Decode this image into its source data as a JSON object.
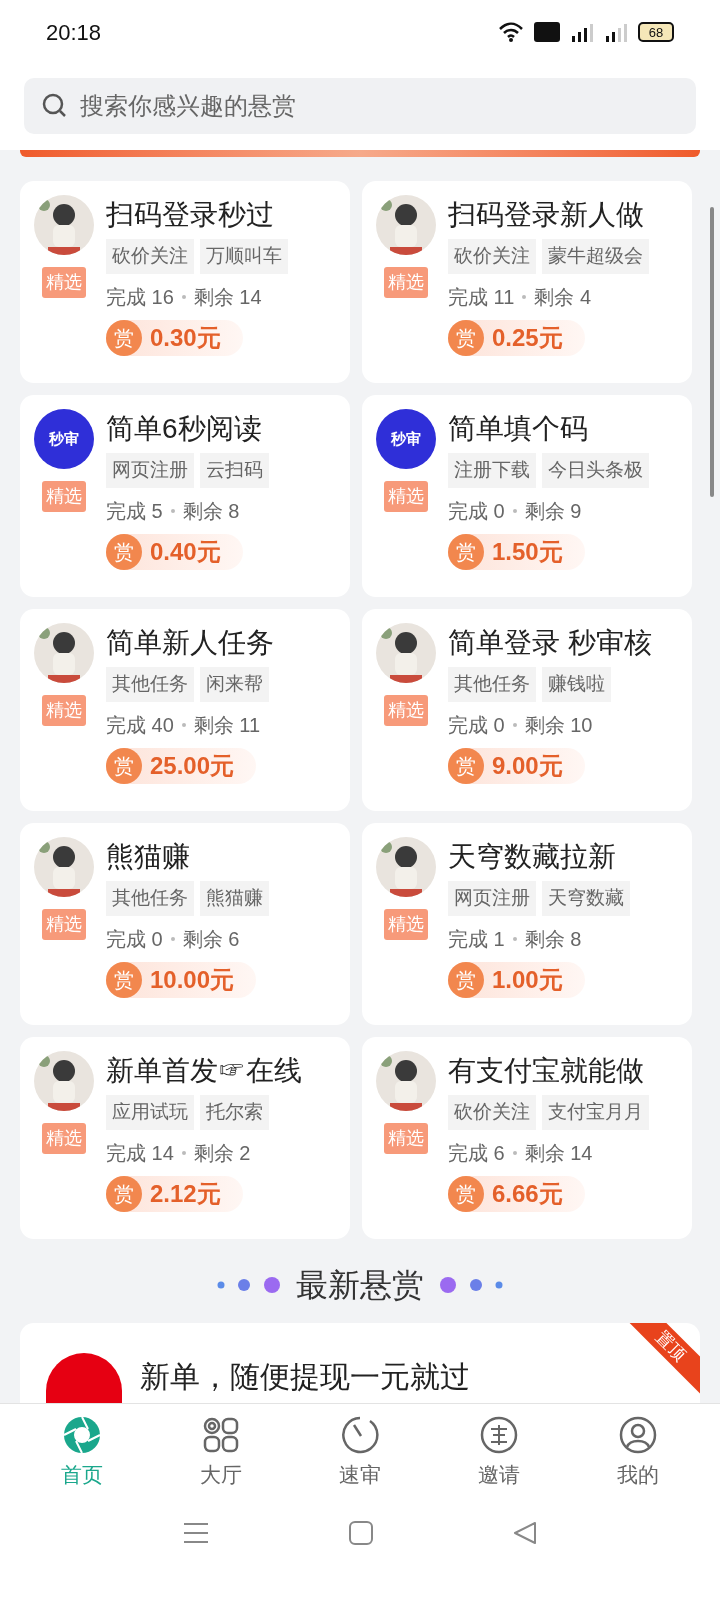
{
  "status_bar": {
    "time": "20:18",
    "battery": "68"
  },
  "search": {
    "placeholder": "搜索你感兴趣的悬赏"
  },
  "cards": [
    {
      "title": "扫码登录秒过",
      "badge": "精选",
      "tags": [
        "砍价关注",
        "万顺叫车"
      ],
      "done": "完成 16",
      "left": "剩余 14",
      "reward_icon": "赏",
      "reward": "0.30元"
    },
    {
      "title": "扫码登录新人做",
      "badge": "精选",
      "tags": [
        "砍价关注",
        "蒙牛超级会"
      ],
      "done": "完成 11",
      "left": "剩余 4",
      "reward_icon": "赏",
      "reward": "0.25元"
    },
    {
      "title": "简单6秒阅读",
      "avatar": {
        "kind": "text",
        "text": "秒审"
      },
      "badge": "精选",
      "tags": [
        "网页注册",
        "云扫码"
      ],
      "done": "完成 5",
      "left": "剩余 8",
      "reward_icon": "赏",
      "reward": "0.40元"
    },
    {
      "title": "简单填个码",
      "avatar": {
        "kind": "text",
        "text": "秒审"
      },
      "badge": "精选",
      "tags": [
        "注册下载",
        "今日头条极"
      ],
      "done": "完成 0",
      "left": "剩余 9",
      "reward_icon": "赏",
      "reward": "1.50元"
    },
    {
      "title": "简单新人任务",
      "badge": "精选",
      "tags": [
        "其他任务",
        "闲来帮"
      ],
      "done": "完成 40",
      "left": "剩余 11",
      "reward_icon": "赏",
      "reward": "25.00元"
    },
    {
      "title": "简单登录 秒审核",
      "badge": "精选",
      "tags": [
        "其他任务",
        "赚钱啦"
      ],
      "done": "完成 0",
      "left": "剩余 10",
      "reward_icon": "赏",
      "reward": "9.00元"
    },
    {
      "title": "熊猫赚",
      "badge": "精选",
      "tags": [
        "其他任务",
        "熊猫赚"
      ],
      "done": "完成 0",
      "left": "剩余 6",
      "reward_icon": "赏",
      "reward": "10.00元"
    },
    {
      "title": "天穹数藏拉新",
      "badge": "精选",
      "tags": [
        "网页注册",
        "天穹数藏"
      ],
      "done": "完成 1",
      "left": "剩余 8",
      "reward_icon": "赏",
      "reward": "1.00元"
    },
    {
      "title": "新单首发☞在线",
      "badge": "精选",
      "tags": [
        "应用试玩",
        "托尔索"
      ],
      "done": "完成 14",
      "left": "剩余 2",
      "reward_icon": "赏",
      "reward": "2.12元"
    },
    {
      "title": "有支付宝就能做",
      "badge": "精选",
      "tags": [
        "砍价关注",
        "支付宝月月"
      ],
      "done": "完成 6",
      "left": "剩余 14",
      "reward_icon": "赏",
      "reward": "6.66元"
    }
  ],
  "latest": {
    "heading": "最新悬赏",
    "card": {
      "title": "新单，随便提现一元就过",
      "pin": "置顶"
    }
  },
  "tab_bar": [
    {
      "label": "首页",
      "kind": "home",
      "selected": true
    },
    {
      "label": "大厅",
      "kind": "grid",
      "selected": false
    },
    {
      "label": "速审",
      "kind": "timer",
      "selected": false
    },
    {
      "label": "邀请",
      "kind": "invite",
      "selected": false
    },
    {
      "label": "我的",
      "kind": "user",
      "selected": false
    }
  ]
}
